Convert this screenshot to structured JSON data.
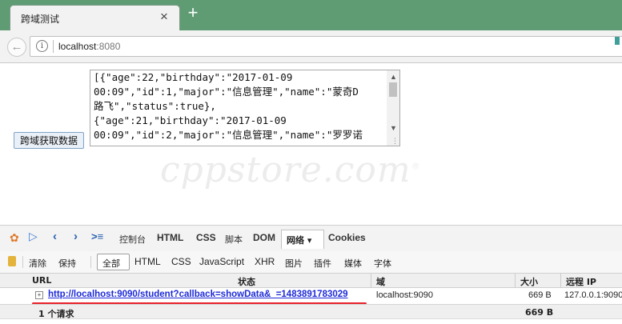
{
  "tab": {
    "title": "跨域测试",
    "close": "×",
    "new_tab": "+"
  },
  "address": {
    "info": "i",
    "host": "localhost",
    "port": ":8080"
  },
  "page": {
    "button_label": "跨域获取数据",
    "textarea_lines": [
      "[{\"age\":22,\"birthday\":\"2017-01-09",
      "00:09\",\"id\":1,\"major\":\"信息管理\",\"name\":\"蒙奇D",
      "路飞\",\"status\":true},",
      "{\"age\":21,\"birthday\":\"2017-01-09",
      "00:09\",\"id\":2,\"major\":\"信息管理\",\"name\":\"罗罗诺"
    ],
    "watermark": "cppstore.com",
    "watermark_mark": "®"
  },
  "firebug": {
    "tabs": [
      "控制台",
      "HTML",
      "CSS",
      "脚本",
      "DOM",
      "网络 ▾",
      "Cookies"
    ],
    "filters": [
      "清除",
      "保持",
      "全部",
      "HTML",
      "CSS",
      "JavaScript",
      "XHR",
      "图片",
      "插件",
      "媒体",
      "字体"
    ],
    "columns": {
      "url": "URL",
      "status": "状态",
      "domain": "域",
      "size": "大小",
      "remote_ip": "远程 IP"
    },
    "request": {
      "url": "http://localhost:9090/student?callback=showData&_=1483891783029",
      "domain": "localhost:9090",
      "size": "669 B",
      "remote_ip": "127.0.0.1:9090"
    },
    "summary": {
      "count": "1 个请求",
      "total_size": "669 B"
    }
  },
  "colors": {
    "tabstrip": "#5f9c74",
    "link": "#1d2ad8",
    "highlight_line": "#e8212b"
  }
}
